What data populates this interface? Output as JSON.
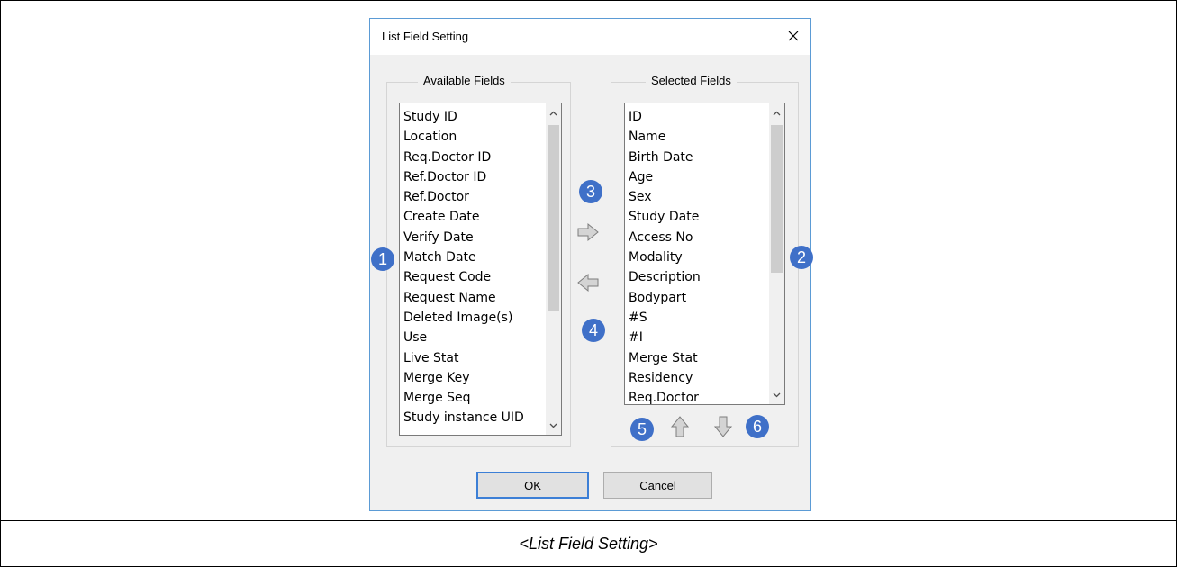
{
  "dialog": {
    "title": "List Field Setting"
  },
  "available": {
    "label": "Available Fields",
    "items": [
      "Study ID",
      "Location",
      "Req.Doctor ID",
      "Ref.Doctor ID",
      "Ref.Doctor",
      "Create Date",
      "Verify Date",
      "Match Date",
      "Request Code",
      "Request Name",
      "Deleted Image(s)",
      "Use",
      "Live Stat",
      "Merge Key",
      "Merge Seq",
      "Study instance UID"
    ]
  },
  "selected": {
    "label": "Selected Fields",
    "items": [
      "ID",
      "Name",
      "Birth Date",
      "Age",
      "Sex",
      "Study Date",
      "Access No",
      "Modality",
      "Description",
      "Bodypart",
      "#S",
      "#I",
      "Merge Stat",
      "Residency",
      "Req.Doctor"
    ]
  },
  "badges": [
    "1",
    "2",
    "3",
    "4",
    "5",
    "6"
  ],
  "buttons": {
    "ok": "OK",
    "cancel": "Cancel"
  },
  "caption": "<List Field Setting>",
  "colors": {
    "badge": "#3f70c8",
    "dialog_border": "#5b9bd5",
    "primary_button_border": "#3c7fd6"
  },
  "icons": {
    "add": "arrow-right-icon",
    "remove": "arrow-left-icon",
    "move_up": "arrow-up-icon",
    "move_down": "arrow-down-icon",
    "close": "close-icon"
  }
}
